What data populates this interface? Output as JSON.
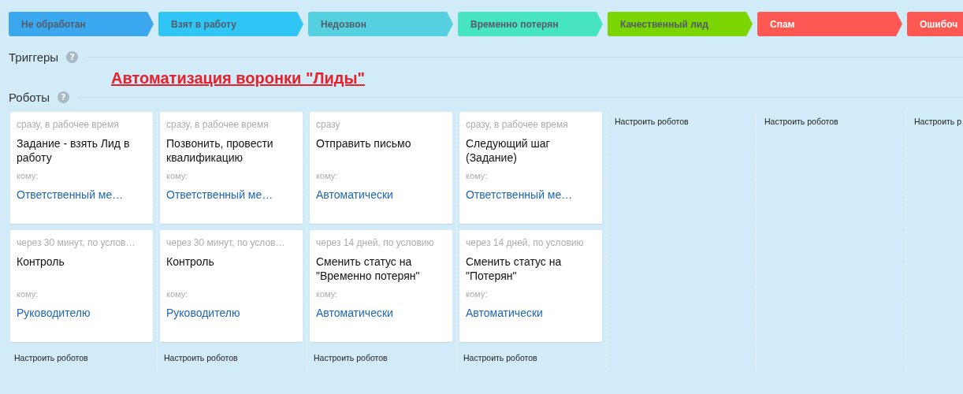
{
  "stages": [
    {
      "label": "Не обработан",
      "color": "#3ba7ee",
      "light_text": false
    },
    {
      "label": "Взят в работу",
      "color": "#2fc6f6",
      "light_text": false
    },
    {
      "label": "Недозвон",
      "color": "#55d0e0",
      "light_text": false
    },
    {
      "label": "Временно потерян",
      "color": "#47e4c2",
      "light_text": false
    },
    {
      "label": "Качественный лид",
      "color": "#7bd500",
      "light_text": false
    },
    {
      "label": "Спам",
      "color": "#ff5752",
      "light_text": true
    },
    {
      "label": "Ошибоч",
      "color": "#ff5752",
      "light_text": true
    }
  ],
  "triggers": {
    "heading": "Триггеры",
    "help": "?"
  },
  "banner_link": "Автоматизация воронки \"Лиды\"",
  "robots": {
    "heading": "Роботы",
    "help": "?"
  },
  "columns": [
    {
      "robots": [
        {
          "delay": "сразу, в рабочее время",
          "title": "Задание - взять Лид в работу",
          "to_label": "кому:",
          "to": "Ответственный ме…"
        },
        {
          "delay": "через 30 минут, по услов…",
          "title": "Контроль",
          "to_label": "кому:",
          "to": "Руководителю"
        }
      ],
      "setup": "Настроить роботов"
    },
    {
      "robots": [
        {
          "delay": "сразу, в рабочее время",
          "title": "Позвонить, провести квалификацию",
          "to_label": "кому:",
          "to": "Ответственный ме…"
        },
        {
          "delay": "через 30 минут, по услов…",
          "title": "Контроль",
          "to_label": "кому:",
          "to": "Руководителю"
        }
      ],
      "setup": "Настроить роботов"
    },
    {
      "robots": [
        {
          "delay": "сразу",
          "title": "Отправить письмо",
          "to_label": "кому:",
          "to": "Автоматически"
        },
        {
          "delay": "через 14 дней, по условию",
          "title": "Сменить статус на \"Временно потерян\"",
          "to_label": "кому:",
          "to": "Автоматически"
        }
      ],
      "setup": "Настроить роботов"
    },
    {
      "robots": [
        {
          "delay": "сразу, в рабочее время",
          "title": "Следующий шаг (Задание)",
          "to_label": "кому:",
          "to": "Ответственный ме…"
        },
        {
          "delay": "через 14 дней, по условию",
          "title": "Сменить статус на \"Потерян\"",
          "to_label": "кому:",
          "to": "Автоматически"
        }
      ],
      "setup": "Настроить роботов"
    },
    {
      "setup": "Настроить роботов"
    },
    {
      "setup": "Настроить роботов"
    },
    {
      "setup": "Настроить р"
    }
  ]
}
